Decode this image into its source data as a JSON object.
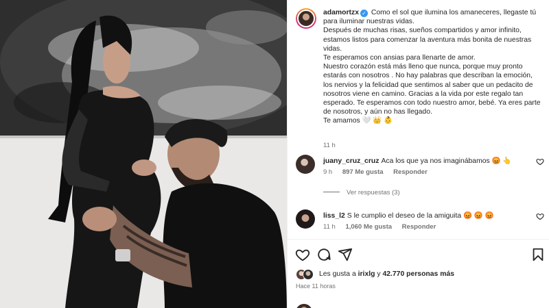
{
  "post": {
    "username": "adamortzx",
    "caption_lines": [
      "Como el sol que ilumina los amaneceres, llegaste tú",
      "para iluminar nuestras vidas.",
      "Después de muchas risas, sueños compartidos y amor infinito,",
      "estamos listos para comenzar la aventura más bonita de nuestras",
      "vidas.",
      "Te esperamos con ansias para llenarte de amor.",
      "Nuestro corazón está más lleno que nunca, porque muy pronto",
      "estarás con nosotros . No hay palabras que describan la emoción,",
      "los nervios y la felicidad que sentimos al saber que un pedacito de",
      "nosotros viene en camino. Gracias a la vida por este regalo tan",
      "esperado. Te esperamos con todo nuestro amor, bebé. Ya eres parte",
      "de nosotros, y aún no has llegado.",
      "Te amamos 🤍 👑 👶"
    ],
    "time": "11 h"
  },
  "comments": [
    {
      "user": "juany_cruz_cruz",
      "text": "Aca los que ya nos imaginábamos 😡 👆",
      "time": "9 h",
      "likes": "897 Me gusta",
      "reply": "Responder",
      "view_replies": "Ver respuestas (3)"
    },
    {
      "user": "liss_l2",
      "text": "S le cumplio el deseo de la amiguita 😡 😡 😡",
      "time": "11 h",
      "likes": "1,060 Me gusta",
      "reply": "Responder"
    }
  ],
  "likes": {
    "prefix": "Les gusta a",
    "user": "irixlg",
    "joiner": "y",
    "count": "42.770 personas más"
  },
  "posted": "Hace 11 horas",
  "icons": {
    "like": "heart-icon",
    "comment": "comment-icon",
    "share": "share-icon",
    "save": "bookmark-icon"
  }
}
